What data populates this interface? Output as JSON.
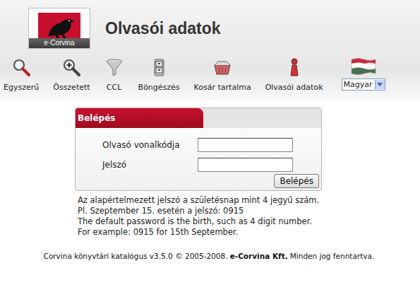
{
  "header": {
    "logo_text": "e·Corvina",
    "title": "Olvasói adatok"
  },
  "nav": [
    {
      "label": "Egyszerű",
      "kind": "search"
    },
    {
      "label": "Összetett",
      "kind": "zoom"
    },
    {
      "label": "CCL",
      "kind": "funnel"
    },
    {
      "label": "Böngészés",
      "kind": "cabinet"
    },
    {
      "label": "Kosár tartalma",
      "kind": "basket"
    },
    {
      "label": "Olvasói adatok",
      "kind": "person"
    }
  ],
  "language": {
    "value": "Magyar"
  },
  "login": {
    "title": "Belépés",
    "fields": [
      {
        "label": "Olvasó vonalkódja",
        "value": "",
        "kind": "text"
      },
      {
        "label": "Jelszó",
        "value": "",
        "kind": "password"
      }
    ],
    "button": "Belépés"
  },
  "info": [
    "Az alapértelmezett jelszó a születésnap mint 4 jegyű szám.",
    "Pl. Szeptember 15. esetén a jelszó: 0915",
    "The default password is the birth, such as 4 digit number.",
    "For example: 0915 for 15th September."
  ],
  "footer": {
    "text": "Corvina könyvtári katalógus v3.5.0 © 2005-2008.",
    "company": "e-Corvina Kft.",
    "rights": "Minden jog fenntartva."
  }
}
